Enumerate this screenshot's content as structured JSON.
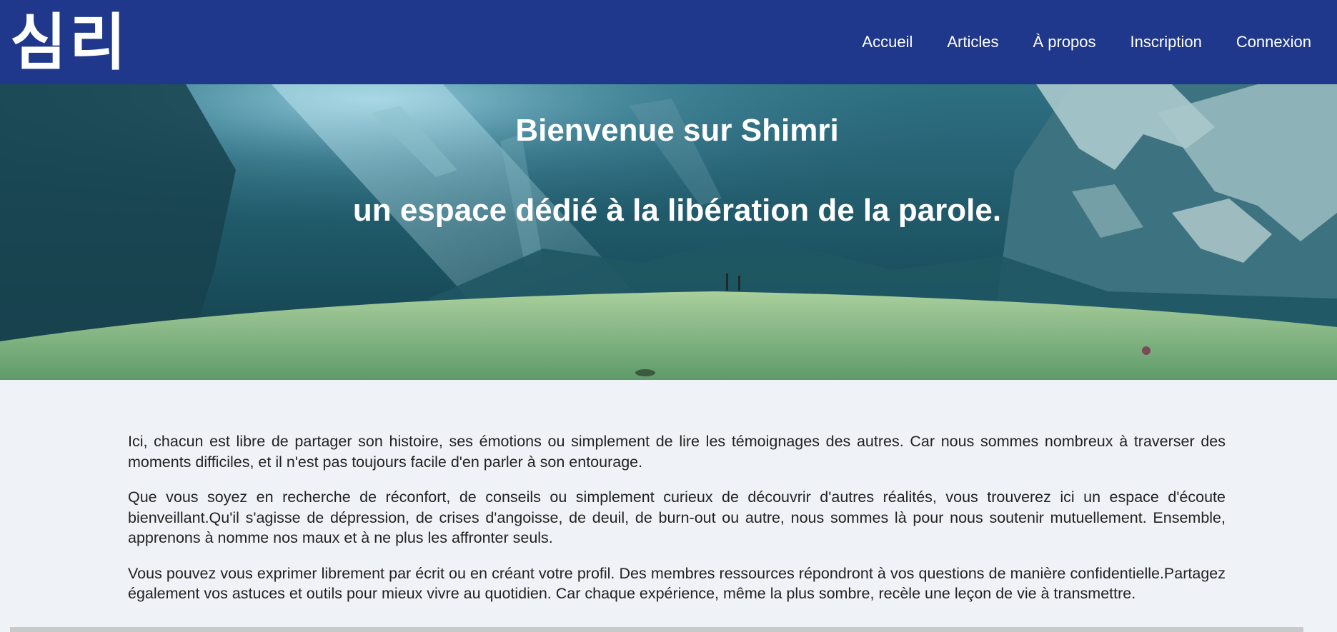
{
  "header": {
    "logo_text": "심리",
    "nav": [
      {
        "label": "Accueil"
      },
      {
        "label": "Articles"
      },
      {
        "label": "À propos"
      },
      {
        "label": "Inscription"
      },
      {
        "label": "Connexion"
      }
    ]
  },
  "hero": {
    "title": "Bienvenue sur Shimri",
    "subtitle": "un espace dédié à la libération de la parole."
  },
  "content": {
    "paragraphs": [
      "Ici, chacun est libre de partager son histoire, ses émotions ou simplement de lire les témoignages des autres. Car nous sommes nombreux à traverser des moments difficiles, et il n'est pas toujours facile d'en parler à son entourage.",
      "Que vous soyez en recherche de réconfort, de conseils ou simplement curieux de découvrir d'autres réalités, vous trouverez ici un espace d'écoute bienveillant.Qu'il s'agisse de dépression, de crises d'angoisse, de deuil, de burn-out ou autre, nous sommes là pour nous soutenir mutuellement. Ensemble, apprenons à nomme nos maux et à ne plus les affronter seuls.",
      "Vous pouvez vous exprimer librement par écrit ou en créant votre profil. Des membres ressources répondront à vos questions de manière confidentielle.Partagez également vos astuces et outils pour mieux vivre au quotidien. Car chaque expérience, même la plus sombre, recèle une leçon de vie à transmettre."
    ]
  },
  "colors": {
    "header_bg": "#1f388c",
    "page_bg": "#eff2f6",
    "text": "#222222",
    "hero_text": "#ffffff"
  }
}
